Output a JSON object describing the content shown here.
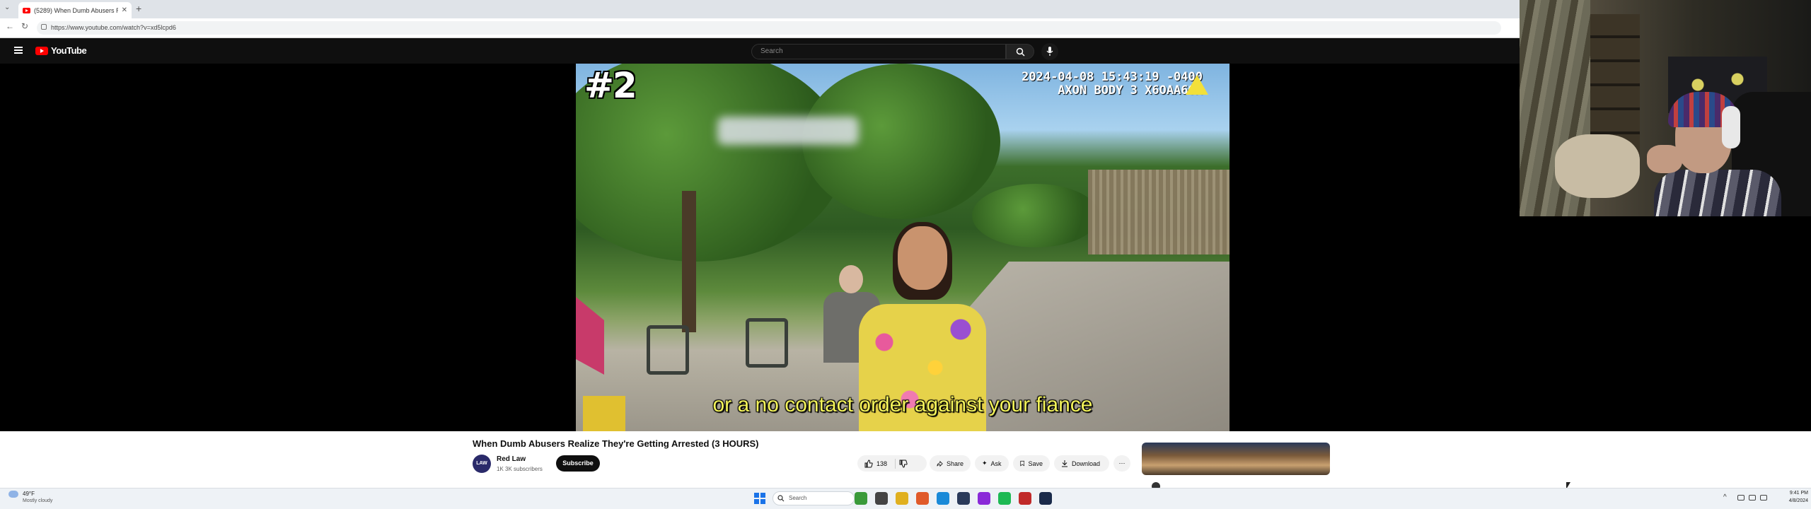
{
  "browser": {
    "tab_title": "(5289) When Dumb Abusers R",
    "tab_close": "✕",
    "new_tab": "+",
    "tab_menu": "⌄",
    "back": "←",
    "reload": "↻",
    "url": "https://www.youtube.com/watch?v=xd5lcpd6"
  },
  "youtube": {
    "logo_text": "YouTube",
    "search_placeholder": "Search"
  },
  "video": {
    "episode_badge": "#2",
    "bodycam_line1": "2024-04-08 15:43:19 -0400",
    "bodycam_line2": "AXON BODY 3 X6OAA6OA",
    "caption": "or a no contact order against your fiance"
  },
  "info": {
    "title": "When Dumb Abusers Realize They're Getting Arrested (3 HOURS)",
    "channel_avatar_text": "LAW",
    "channel_name": "Red Law",
    "channel_subs": "1K 3K subscribers",
    "subscribe_label": "Subscribe",
    "like_count": "138",
    "share_label": "Share",
    "ask_label": "Ask",
    "save_label": "Save",
    "download_label": "Download",
    "more_label": "⋯"
  },
  "taskbar": {
    "weather_temp": "49°F",
    "weather_desc": "Mostly cloudy",
    "search_placeholder": "Search",
    "tray_chevron": "^",
    "clock_time": "9:41 PM",
    "clock_date": "4/8/2024"
  },
  "colors": {
    "youtube_red": "#ff0000",
    "caption_yellow": "#f3f35a",
    "header_bg": "#0f0f0f",
    "start_blue": "#1a73e8"
  },
  "taskbar_apps": [
    {
      "name": "taskbar-app-1-icon",
      "color": "#3a9a3a"
    },
    {
      "name": "taskbar-app-2-icon",
      "color": "#444"
    },
    {
      "name": "taskbar-app-3-icon",
      "color": "#e0b020"
    },
    {
      "name": "taskbar-app-4-icon",
      "color": "#e05a2a"
    },
    {
      "name": "taskbar-app-5-icon",
      "color": "#1a8ad8"
    },
    {
      "name": "taskbar-app-6-icon",
      "color": "#2a3a5a"
    },
    {
      "name": "taskbar-app-7-icon",
      "color": "#8a2ad8"
    },
    {
      "name": "taskbar-app-8-icon",
      "color": "#1db954"
    },
    {
      "name": "taskbar-app-9-icon",
      "color": "#c02a2a"
    },
    {
      "name": "taskbar-app-10-icon",
      "color": "#1a2a4a"
    }
  ]
}
